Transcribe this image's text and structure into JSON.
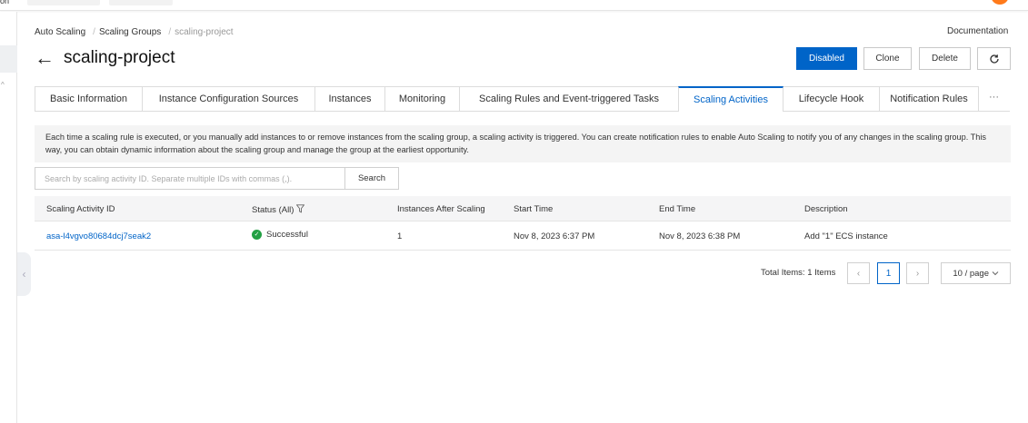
{
  "topbar": {
    "left_fragment": "on"
  },
  "breadcrumb": [
    "Auto Scaling",
    "Scaling Groups",
    "scaling-project"
  ],
  "documentation_link": "Documentation",
  "page_title": "scaling-project",
  "actions": {
    "disabled": "Disabled",
    "clone": "Clone",
    "delete": "Delete",
    "refresh_icon": "refresh-icon"
  },
  "tabs": [
    "Basic Information",
    "Instance Configuration Sources",
    "Instances",
    "Monitoring",
    "Scaling Rules and Event-triggered Tasks",
    "Scaling Activities",
    "Lifecycle Hook",
    "Notification Rules"
  ],
  "active_tab": "Scaling Activities",
  "more_tabs": "···",
  "notice": "Each time a scaling rule is executed, or you manually add instances to or remove instances from the scaling group, a scaling activity is triggered. You can create notification rules to enable Auto Scaling to notify you of any changes in the scaling group. This way, you can obtain dynamic information about the scaling group and manage the group at the earliest opportunity.",
  "search": {
    "placeholder": "Search by scaling activity ID. Separate multiple IDs with commas (,).",
    "button": "Search"
  },
  "table": {
    "columns": [
      "Scaling Activity ID",
      "Status (All)",
      "Instances After Scaling",
      "Start Time",
      "End Time",
      "Description"
    ],
    "rows": [
      {
        "id": "asa-l4vgvo80684dcj7seak2",
        "status": "Successful",
        "instances_after": "1",
        "start_time": "Nov 8, 2023 6:37 PM",
        "end_time": "Nov 8, 2023 6:38 PM",
        "description": "Add \"1\" ECS instance"
      }
    ]
  },
  "pagination": {
    "total": "Total Items: 1 Items",
    "page": "1",
    "page_size": "10 / page"
  },
  "colors": {
    "primary": "#0064c8",
    "success": "#23a044",
    "avatar": "#ff7a1a"
  }
}
